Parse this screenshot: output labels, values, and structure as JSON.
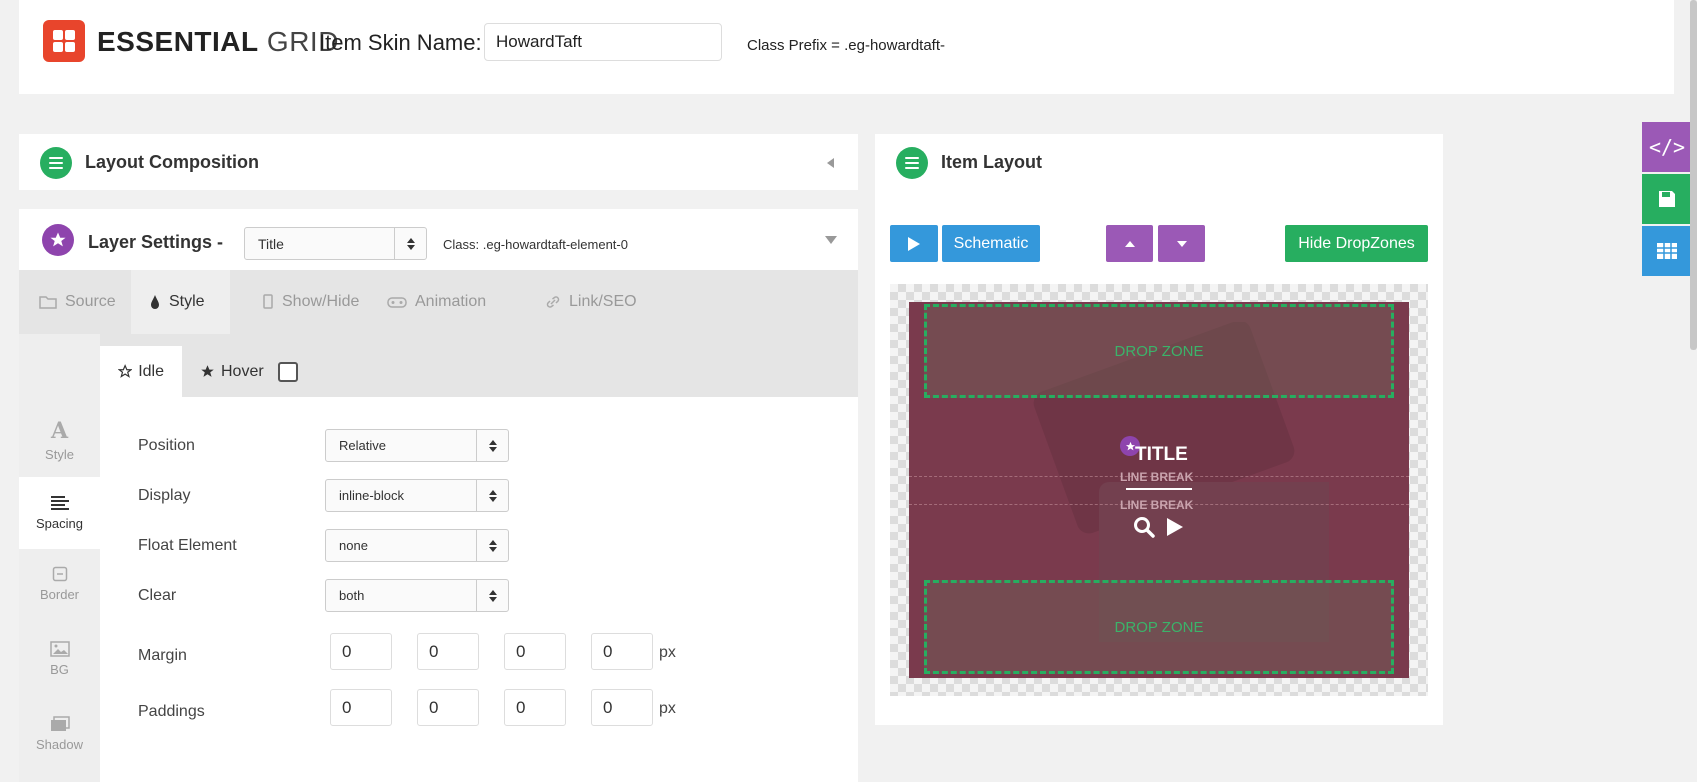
{
  "header": {
    "brand_bold": "ESSENTIAL",
    "brand_light": "GRID",
    "skin_name_label": "Item Skin Name:",
    "skin_name_value": "HowardTaft",
    "class_prefix": "Class Prefix = .eg-howardtaft-"
  },
  "layout_composition": {
    "title": "Layout Composition"
  },
  "layer_settings": {
    "title": "Layer Settings -",
    "selected_layer": "Title",
    "class_label": "Class: .eg-howardtaft-element-0"
  },
  "tabs": [
    {
      "label": "Source",
      "icon": "folder-icon"
    },
    {
      "label": "Style",
      "icon": "drop-icon"
    },
    {
      "label": "Show/Hide",
      "icon": "tablet-icon"
    },
    {
      "label": "Animation",
      "icon": "gamepad-icon"
    },
    {
      "label": "Link/SEO",
      "icon": "link-icon"
    }
  ],
  "side_nav": [
    {
      "label": "Style",
      "icon": "font-icon"
    },
    {
      "label": "Spacing",
      "icon": "align-icon"
    },
    {
      "label": "Border",
      "icon": "border-icon"
    },
    {
      "label": "BG",
      "icon": "image-icon"
    },
    {
      "label": "Shadow",
      "icon": "shadow-icon"
    }
  ],
  "state_tabs": {
    "idle": "Idle",
    "hover": "Hover"
  },
  "form": {
    "position_label": "Position",
    "position_value": "Relative",
    "display_label": "Display",
    "display_value": "inline-block",
    "float_label": "Float Element",
    "float_value": "none",
    "clear_label": "Clear",
    "clear_value": "both",
    "margin_label": "Margin",
    "margin_values": [
      "0",
      "0",
      "0",
      "0"
    ],
    "padding_label": "Paddings",
    "padding_values": [
      "0",
      "0",
      "0",
      "0"
    ],
    "unit": "px"
  },
  "item_layout": {
    "title": "Item Layout",
    "schematic_label": "Schematic",
    "hide_dropzones_label": "Hide DropZones",
    "dropzone_top": "DROP ZONE",
    "dropzone_bottom": "DROP ZONE",
    "preview_title": "TITLE",
    "line_break_1": "LINE BREAK",
    "line_break_2": "LINE BREAK"
  },
  "right_toolbar": [
    "code-icon",
    "save-icon",
    "grid-icon"
  ],
  "colors": {
    "brand": "#e8452c",
    "green": "#27ae60",
    "purple": "#8e44ad",
    "blue": "#3498db",
    "violet": "#9b59b6",
    "card": "#7a3a4d"
  }
}
